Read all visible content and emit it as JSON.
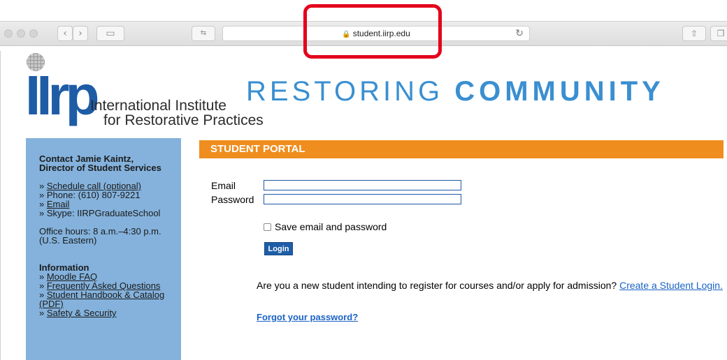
{
  "browser": {
    "url": "student.iirp.edu",
    "back_icon": "chevron-left-icon",
    "forward_icon": "chevron-right-icon",
    "sidebar_icon": "sidebar-icon",
    "share_icon": "share-icon",
    "tabs_icon": "tabs-icon",
    "highlight_color": "#e3001b"
  },
  "header": {
    "logo_letters": "IIrp",
    "logo_line1": "International Institute",
    "logo_line2": "for Restorative Practices",
    "hero_light": "RESTORING",
    "hero_bold": "COMMUNITY"
  },
  "sidebar": {
    "contact_heading_1": "Contact Jamie Kaintz,",
    "contact_heading_2": "Director of Student Services",
    "schedule_link": "Schedule call (optional)",
    "phone": "» Phone: (610) 807-9221",
    "email_link": "Email",
    "skype": "» Skype: IIRPGraduateSchool",
    "hours_1": "Office hours: 8 a.m.–4:30 p.m.",
    "hours_2": "(U.S. Eastern)",
    "info_heading": "Information",
    "info_links": [
      "Moodle FAQ",
      "Frequently Asked Questions",
      "Student Handbook & Catalog",
      "(PDF)",
      "Safety & Security"
    ],
    "bullet": "» "
  },
  "main": {
    "section_title": "STUDENT PORTAL",
    "email_label": "Email",
    "password_label": "Password",
    "email_value": "",
    "password_value": "",
    "save_label": "Save email and password",
    "login_label": "Login",
    "new_student_text": "Are you a new student intending to register for courses and/or apply for admission?",
    "create_login_link": "Create a Student Login.",
    "forgot_link": "Forgot your password?"
  },
  "colors": {
    "portal_bar": "#ef8e1f",
    "sidebar_bg": "#84b2dc",
    "brand_blue": "#1f5ca6",
    "link_blue": "#1a62c5"
  }
}
